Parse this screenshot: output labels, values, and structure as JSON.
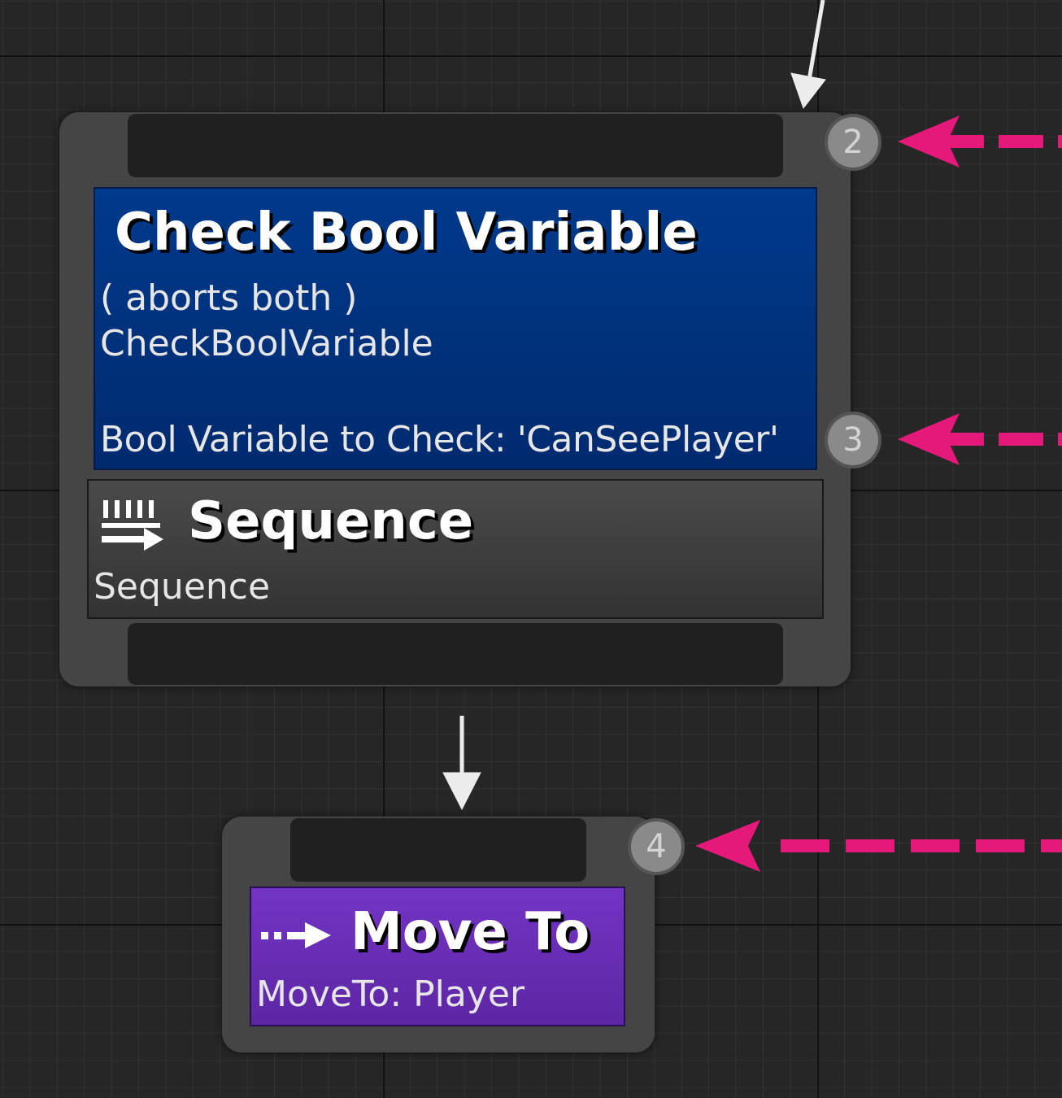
{
  "node_check": {
    "decorator": {
      "title": "Check Bool Variable",
      "abort_mode": "( aborts both )",
      "class_name": "CheckBoolVariable",
      "detail": "Bool Variable to Check: 'CanSeePlayer'",
      "color": "#003a8c",
      "badge": "3"
    },
    "composite": {
      "title": "Sequence",
      "subtitle": "Sequence",
      "icon": "sequence-icon"
    },
    "badge": "2"
  },
  "node_move": {
    "title": "Move To",
    "subtitle": "MoveTo: Player",
    "icon": "move-to-icon",
    "color": "#6a2fb8",
    "badge": "4"
  },
  "annotation_color": "#e5197a"
}
